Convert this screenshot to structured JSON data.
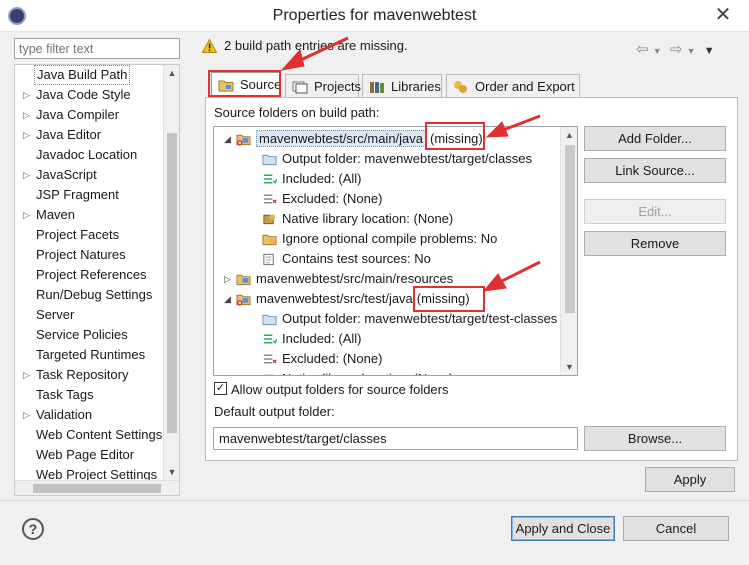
{
  "window": {
    "title": "Properties for mavenwebtest",
    "close_glyph": "✕"
  },
  "filter": {
    "placeholder": "type filter text"
  },
  "nav": {
    "items": [
      {
        "label": "Java Build Path",
        "expandable": false,
        "selected": true
      },
      {
        "label": "Java Code Style",
        "expandable": true
      },
      {
        "label": "Java Compiler",
        "expandable": true
      },
      {
        "label": "Java Editor",
        "expandable": true
      },
      {
        "label": "Javadoc Location",
        "expandable": false
      },
      {
        "label": "JavaScript",
        "expandable": true
      },
      {
        "label": "JSP Fragment",
        "expandable": false
      },
      {
        "label": "Maven",
        "expandable": true
      },
      {
        "label": "Project Facets",
        "expandable": false
      },
      {
        "label": "Project Natures",
        "expandable": false
      },
      {
        "label": "Project References",
        "expandable": false
      },
      {
        "label": "Run/Debug Settings",
        "expandable": false
      },
      {
        "label": "Server",
        "expandable": false
      },
      {
        "label": "Service Policies",
        "expandable": false
      },
      {
        "label": "Targeted Runtimes",
        "expandable": false
      },
      {
        "label": "Task Repository",
        "expandable": true
      },
      {
        "label": "Task Tags",
        "expandable": false
      },
      {
        "label": "Validation",
        "expandable": true
      },
      {
        "label": "Web Content Settings",
        "expandable": false
      },
      {
        "label": "Web Page Editor",
        "expandable": false
      },
      {
        "label": "Web Project Settings",
        "expandable": false
      }
    ]
  },
  "message": {
    "text": "2 build path entries are missing.",
    "icon": "warning-icon"
  },
  "tabs": [
    {
      "label": "Source",
      "active": true,
      "icon": "source-folder-icon"
    },
    {
      "label": "Projects",
      "icon": "projects-icon"
    },
    {
      "label": "Libraries",
      "icon": "libraries-icon"
    },
    {
      "label": "Order and Export",
      "icon": "order-export-icon"
    }
  ],
  "source": {
    "heading": "Source folders on build path:",
    "tree": [
      {
        "text": "mavenwebtest/src/main/java",
        "suffix": "(missing)",
        "level": 0,
        "twisty": "◢",
        "icon": "source-folder-error-icon",
        "selected": true
      },
      {
        "text": "Output folder: mavenwebtest/target/classes",
        "level": 1,
        "icon": "output-folder-icon"
      },
      {
        "text": "Included: (All)",
        "level": 1,
        "icon": "included-icon"
      },
      {
        "text": "Excluded: (None)",
        "level": 1,
        "icon": "excluded-icon"
      },
      {
        "text": "Native library location: (None)",
        "level": 1,
        "icon": "native-library-icon"
      },
      {
        "text": "Ignore optional compile problems: No",
        "level": 1,
        "icon": "ignore-problems-icon"
      },
      {
        "text": "Contains test sources: No",
        "level": 1,
        "icon": "test-sources-icon"
      },
      {
        "text": "mavenwebtest/src/main/resources",
        "level": 0,
        "twisty": "▷",
        "icon": "source-folder-icon"
      },
      {
        "text": "mavenwebtest/src/test/java",
        "suffix": "(missing)",
        "level": 0,
        "twisty": "◢",
        "icon": "source-folder-error-icon"
      },
      {
        "text": "Output folder: mavenwebtest/target/test-classes",
        "level": 1,
        "icon": "output-folder-icon"
      },
      {
        "text": "Included: (All)",
        "level": 1,
        "icon": "included-icon"
      },
      {
        "text": "Excluded: (None)",
        "level": 1,
        "icon": "excluded-icon"
      },
      {
        "text": "Native library location: (None)",
        "level": 1,
        "icon": "native-library-icon"
      }
    ],
    "buttons": {
      "add_folder": "Add Folder...",
      "link_source": "Link Source...",
      "edit": "Edit...",
      "remove": "Remove"
    },
    "allow_output_label": "Allow output folders for source folders",
    "allow_output_checked": true,
    "default_output_label": "Default output folder:",
    "default_output_value": "mavenwebtest/target/classes",
    "browse_label": "Browse..."
  },
  "buttons": {
    "apply": "Apply",
    "apply_close": "Apply and Close",
    "cancel": "Cancel"
  },
  "colors": {
    "annotation": "#e03030",
    "selection": "#dbe9f7"
  }
}
